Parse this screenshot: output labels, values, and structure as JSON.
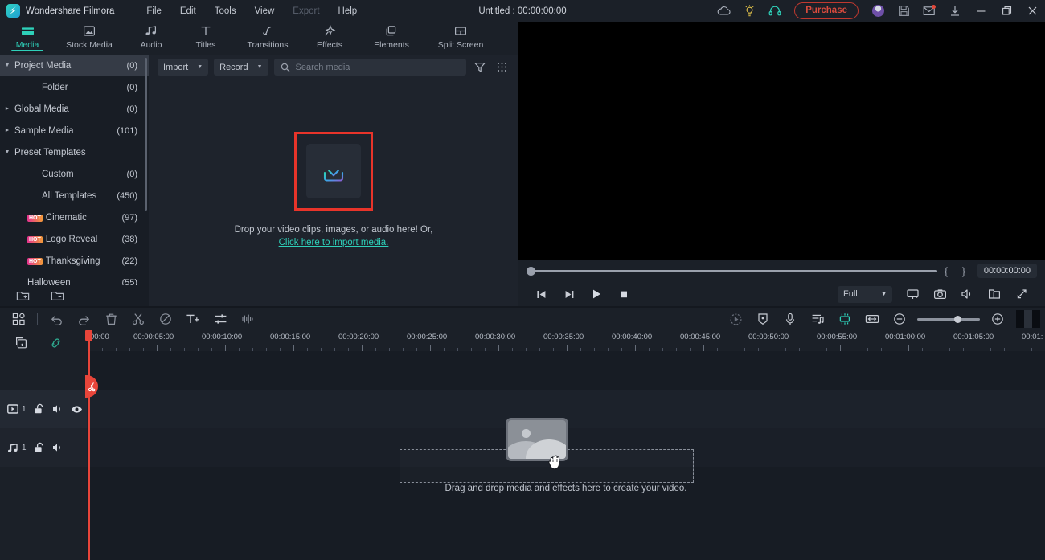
{
  "titlebar": {
    "app_name": "Wondershare Filmora",
    "menus": [
      {
        "label": "File",
        "disabled": false
      },
      {
        "label": "Edit",
        "disabled": false
      },
      {
        "label": "Tools",
        "disabled": false
      },
      {
        "label": "View",
        "disabled": false
      },
      {
        "label": "Export",
        "disabled": true
      },
      {
        "label": "Help",
        "disabled": false
      }
    ],
    "document_title": "Untitled : 00:00:00:00",
    "purchase_label": "Purchase",
    "icons": [
      "cloud-icon",
      "lightbulb-icon",
      "headset-icon",
      "avatar-icon",
      "save-icon",
      "mail-icon",
      "download-icon",
      "minimize-icon",
      "maximize-icon",
      "close-icon"
    ],
    "accent_red": "#d94b3d"
  },
  "tabs": {
    "items": [
      {
        "label": "Media",
        "icon": "media-folder-icon",
        "active": true
      },
      {
        "label": "Stock Media",
        "icon": "stock-media-icon",
        "active": false
      },
      {
        "label": "Audio",
        "icon": "audio-note-icon",
        "active": false
      },
      {
        "label": "Titles",
        "icon": "titles-text-icon",
        "active": false
      },
      {
        "label": "Transitions",
        "icon": "transitions-icon",
        "active": false
      },
      {
        "label": "Effects",
        "icon": "effects-sparkle-icon",
        "active": false
      },
      {
        "label": "Elements",
        "icon": "elements-stack-icon",
        "active": false
      },
      {
        "label": "Split Screen",
        "icon": "split-screen-icon",
        "active": false
      }
    ],
    "export_label": "Export",
    "active_color": "#2ed0b9"
  },
  "sidebar": {
    "items": [
      {
        "label": "Project Media",
        "count": "(0)",
        "arrow": "down",
        "selected": true,
        "indent": 0,
        "hot": false
      },
      {
        "label": "Folder",
        "count": "(0)",
        "arrow": "none",
        "selected": false,
        "indent": 1,
        "hot": false
      },
      {
        "label": "Global Media",
        "count": "(0)",
        "arrow": "right",
        "selected": false,
        "indent": 0,
        "hot": false
      },
      {
        "label": "Sample Media",
        "count": "(101)",
        "arrow": "right",
        "selected": false,
        "indent": 0,
        "hot": false
      },
      {
        "label": "Preset Templates",
        "count": "",
        "arrow": "down",
        "selected": false,
        "indent": 0,
        "hot": false
      },
      {
        "label": "Custom",
        "count": "(0)",
        "arrow": "none",
        "selected": false,
        "indent": 1,
        "hot": false
      },
      {
        "label": "All Templates",
        "count": "(450)",
        "arrow": "none",
        "selected": false,
        "indent": 1,
        "hot": false
      },
      {
        "label": "Cinematic",
        "count": "(97)",
        "arrow": "none",
        "selected": false,
        "indent": 2,
        "hot": true
      },
      {
        "label": "Logo Reveal",
        "count": "(38)",
        "arrow": "none",
        "selected": false,
        "indent": 2,
        "hot": true
      },
      {
        "label": "Thanksgiving",
        "count": "(22)",
        "arrow": "none",
        "selected": false,
        "indent": 2,
        "hot": true
      },
      {
        "label": "Halloween",
        "count": "(55)",
        "arrow": "none",
        "selected": false,
        "indent": 2,
        "hot": false
      }
    ],
    "hot_badge_label": "HOT",
    "footer_icons": [
      "new-folder-icon",
      "delete-folder-icon"
    ],
    "collapse_icon": "collapse-left-icon"
  },
  "media_panel": {
    "import_label": "Import",
    "record_label": "Record",
    "search_placeholder": "Search media",
    "search_value": "",
    "filter_icon": "filter-icon",
    "grid_icon": "grid-view-icon",
    "drop_text": "Drop your video clips, images, or audio here! Or,",
    "drop_link": "Click here to import media.",
    "import_icon": "import-download-icon",
    "highlight_color": "#e8342a"
  },
  "preview": {
    "timecode": "00:00:00:00",
    "mark_in": "{",
    "mark_out": "}",
    "quality": "Full",
    "left_controls": [
      "prev-frame-icon",
      "next-frame-icon",
      "play-icon",
      "stop-icon"
    ],
    "right_controls": [
      "screen-cast-icon",
      "snapshot-icon",
      "volume-icon",
      "open-folder-icon",
      "fullscreen-icon"
    ]
  },
  "timeline": {
    "toolbar_left_icons": [
      "templates-grid-icon",
      "undo-icon",
      "redo-icon",
      "delete-icon",
      "split-scissors-icon",
      "crop-disable-icon",
      "add-text-icon",
      "adjust-sliders-icon",
      "audio-waveform-icon"
    ],
    "toolbar_right_icons": [
      "render-preview-icon",
      "marker-icon",
      "voiceover-mic-icon",
      "audio-mixer-icon",
      "auto-highlight-icon",
      "fit-timeline-icon",
      "zoom-out-icon",
      "zoom-in-icon"
    ],
    "subbar_icons": [
      "add-track-icon",
      "link-chain-icon"
    ],
    "ruler_labels": [
      "00:00",
      "00:00:05:00",
      "00:00:10:00",
      "00:00:15:00",
      "00:00:20:00",
      "00:00:25:00",
      "00:00:30:00",
      "00:00:35:00",
      "00:00:40:00",
      "00:00:45:00",
      "00:00:50:00",
      "00:00:55:00",
      "00:01:00:00",
      "00:01:05:00",
      "00:01:"
    ],
    "tracks": [
      {
        "type": "video",
        "number": "1",
        "icons": [
          "video-track-icon",
          "unlock-icon",
          "mute-icon",
          "eye-visible-icon"
        ]
      },
      {
        "type": "audio",
        "number": "1",
        "icons": [
          "audio-track-icon",
          "unlock-icon",
          "mute-icon"
        ]
      }
    ],
    "hint_text": "Drag and drop media and effects here to create your video.",
    "playhead_badge_icon": "split-scissors-icon",
    "drag_ghost_icon": "media-thumbnail-placeholder",
    "cursor_icon": "grabbing-hand-cursor",
    "zoom_percent": 60
  }
}
